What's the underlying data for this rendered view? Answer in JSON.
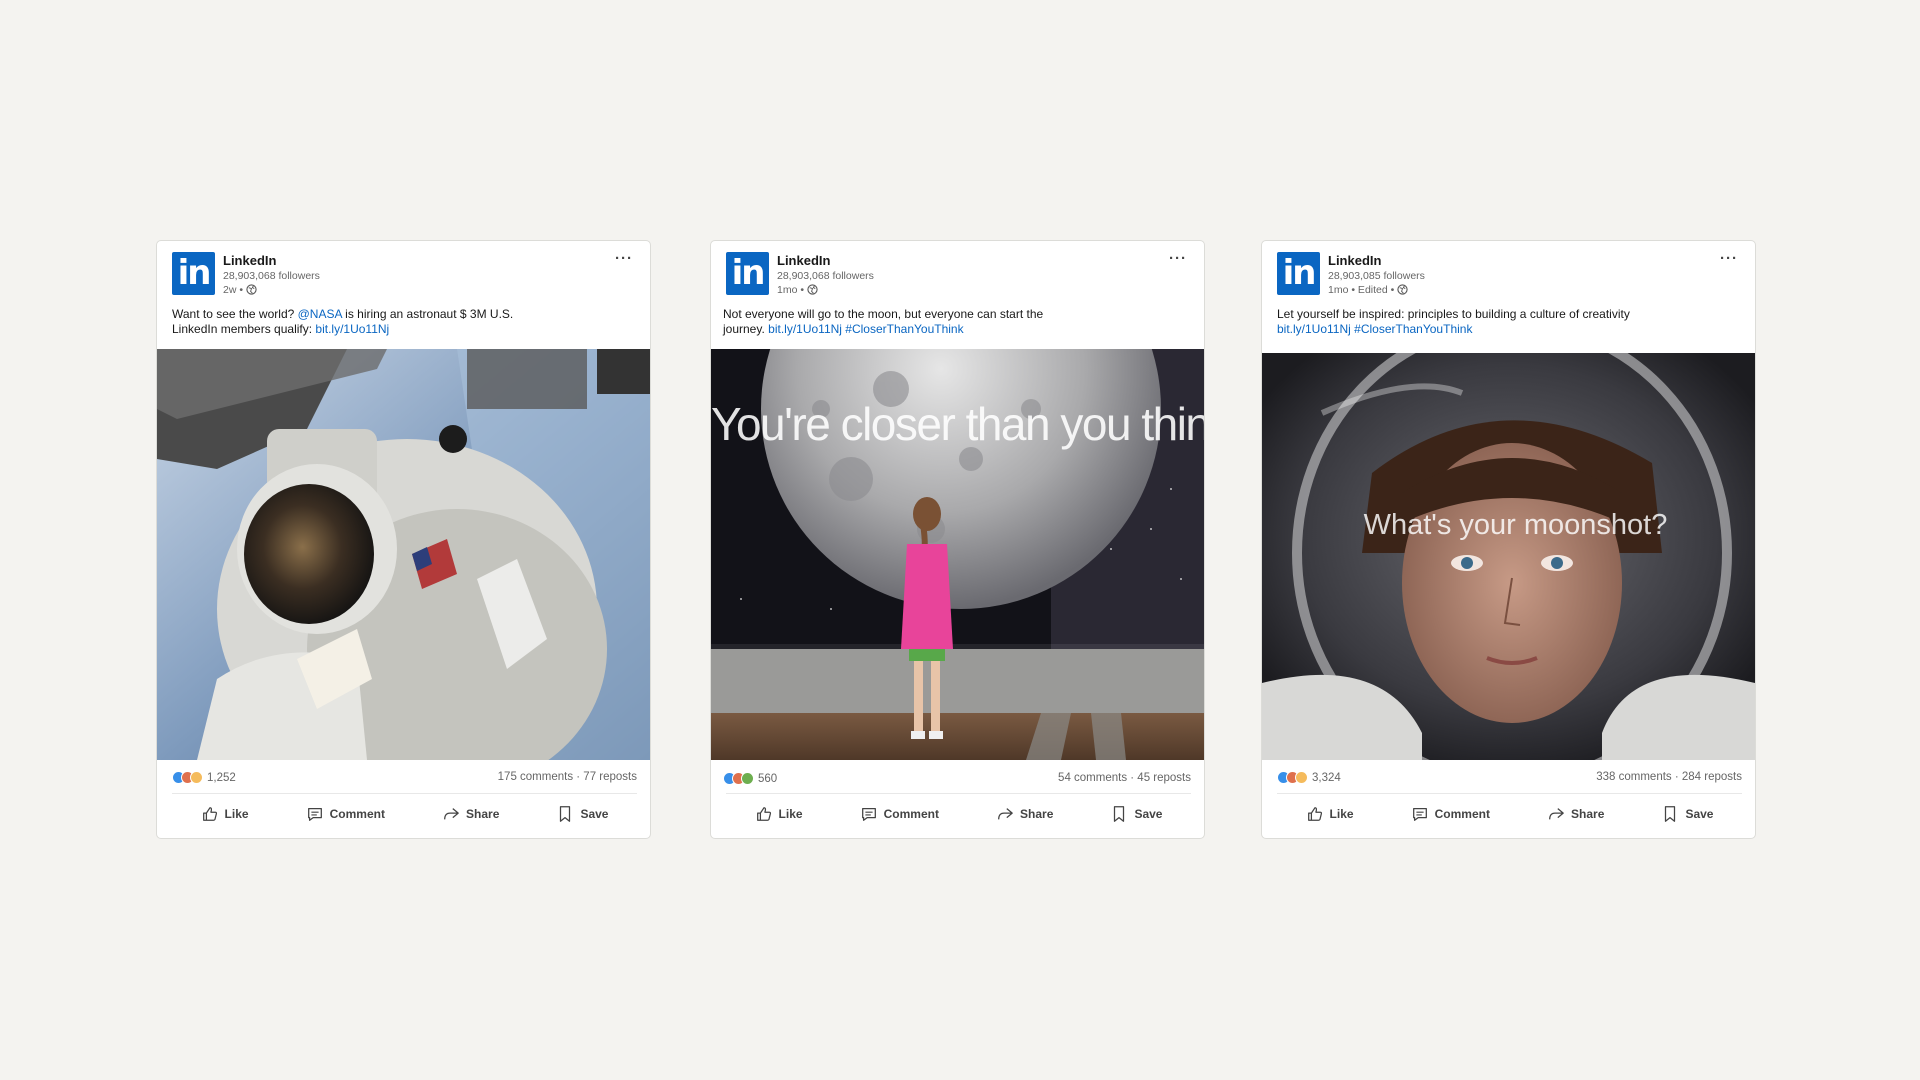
{
  "cards": [
    {
      "company": "LinkedIn",
      "followers": "28,903,068 followers",
      "time": "2w •",
      "caption_pre": "Want to see the world? ",
      "mention": "@NASA",
      "caption_mid": " is hiring an astronaut $ 3M U.S.",
      "caption_line2": "LinkedIn members qualify: ",
      "link": "bit.ly/1Uo11Nj",
      "reaction_count": "1,252",
      "counts": "175 comments · 77 reposts"
    },
    {
      "company": "LinkedIn",
      "followers": "28,903,068 followers",
      "time": "1mo •",
      "caption_pre": "Not everyone will go to the moon, but everyone can start the",
      "caption_line2": "journey. ",
      "link": "bit.ly/1Uo11Nj",
      "hashtag": "#CloserThanYouThink",
      "overlay": "You're closer than you think",
      "reaction_count": "560",
      "counts": "54 comments · 45 reposts"
    },
    {
      "company": "LinkedIn",
      "followers": "28,903,085 followers",
      "time": "1mo • Edited •",
      "caption_pre": "Let yourself be inspired: principles to building a culture of creativity",
      "link": "bit.ly/1Uo11Nj",
      "hashtag": "#CloserThanYouThink",
      "overlay": "What's your moonshot?",
      "reaction_count": "3,324",
      "counts": "338 comments · 284 reposts"
    }
  ],
  "actions": {
    "like": "Like",
    "comment": "Comment",
    "share": "Share",
    "save": "Save"
  },
  "logo_text": "in",
  "more_label": "···",
  "colors": {
    "linkedin_blue": "#0a66c2",
    "background": "#f4f3f0",
    "text_secondary": "#666666"
  },
  "icons": [
    "globe-icon",
    "more-icon",
    "like-icon",
    "comment-icon",
    "share-icon",
    "save-icon"
  ]
}
